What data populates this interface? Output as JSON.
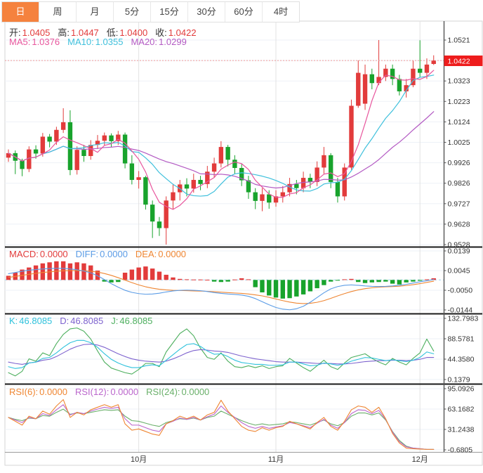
{
  "tabs": [
    {
      "label": "日",
      "selected": true
    },
    {
      "label": "周",
      "selected": false
    },
    {
      "label": "月",
      "selected": false
    },
    {
      "label": "5分",
      "selected": false
    },
    {
      "label": "15分",
      "selected": false
    },
    {
      "label": "30分",
      "selected": false
    },
    {
      "label": "60分",
      "selected": false
    },
    {
      "label": "4时",
      "selected": false
    }
  ],
  "legends": {
    "ohlc": [
      {
        "label": "开:",
        "value": "1.0405"
      },
      {
        "label": "高:",
        "value": "1.0447"
      },
      {
        "label": "低:",
        "value": "1.0400"
      },
      {
        "label": "收:",
        "value": "1.0422"
      }
    ],
    "ma": [
      {
        "label": "MA5:",
        "value": "1.0376",
        "color": "ma5"
      },
      {
        "label": "MA10:",
        "value": "1.0355",
        "color": "ma10"
      },
      {
        "label": "MA20:",
        "value": "1.0299",
        "color": "ma20"
      }
    ],
    "macd": [
      {
        "label": "MACD:",
        "value": "0.0000",
        "color": "up"
      },
      {
        "label": "DIFF:",
        "value": "0.0000",
        "color": "diff"
      },
      {
        "label": "DEA:",
        "value": "0.0000",
        "color": "dea"
      }
    ],
    "kdj": [
      {
        "label": "K:",
        "value": "46.8085",
        "color": "k"
      },
      {
        "label": "D:",
        "value": "46.8085",
        "color": "d"
      },
      {
        "label": "J:",
        "value": "46.8085",
        "color": "j"
      }
    ],
    "rsi": [
      {
        "label": "RSI(6):",
        "value": "0.0000",
        "color": "rsi6"
      },
      {
        "label": "RSI(12):",
        "value": "0.0000",
        "color": "rsi12"
      },
      {
        "label": "RSI(24):",
        "value": "0.0000",
        "color": "rsi24"
      }
    ]
  },
  "colors": {
    "up": "#e23b3b",
    "down": "#18a32c",
    "tag": "#ee1c1c",
    "tagText": "#ffffff",
    "ma5": "#e8569d",
    "ma10": "#3fc0dc",
    "ma20": "#b35ac3",
    "diff": "#5b9ce6",
    "dea": "#ef8632",
    "k": "#2fc2dc",
    "d": "#7d62ce",
    "j": "#4daf5e",
    "rsi6": "#ef8632",
    "rsi12": "#bb66cc",
    "rsi24": "#6ab06a",
    "grid": "#edf1f7",
    "monthLine": "#e2e2e2",
    "frame": "#d6d6d6",
    "axisLine": "#555555",
    "axisText": "#333333",
    "sep": "#1a1a1a",
    "priceDotted": "#ef9a9a",
    "macdZero": "#9fd4ef"
  },
  "chart_data": {
    "type": "candlestick",
    "current_price": "1.0422",
    "ylim_main": [
      0.9528,
      1.0521
    ],
    "ma_periods": [
      5,
      10,
      20
    ],
    "y_axis": {
      "main": [
        "1.0521",
        "1.0422",
        "1.0323",
        "1.0223",
        "1.0124",
        "1.0025",
        "0.9926",
        "0.9826",
        "0.9727",
        "0.9628",
        "0.9528"
      ],
      "macd": [
        "0.0139",
        "0.0045",
        "-0.0050",
        "-0.0144"
      ],
      "kdj": [
        "132.7983",
        "88.5781",
        "44.3580",
        "0.1379"
      ],
      "rsi": [
        "95.0926",
        "63.1682",
        "31.2438",
        "-0.6805"
      ]
    },
    "x_axis": {
      "labels": [
        "10月",
        "11月",
        "12月"
      ],
      "candle_indices": [
        19,
        39,
        60
      ]
    },
    "candles": [
      [
        0.995,
        0.999,
        0.993,
        0.9972
      ],
      [
        0.9972,
        0.9985,
        0.987,
        0.9935
      ],
      [
        0.9935,
        0.9945,
        0.986,
        0.9895
      ],
      [
        0.9895,
        1.0005,
        0.988,
        0.999
      ],
      [
        0.999,
        1.001,
        0.9945,
        0.997
      ],
      [
        0.997,
        1.007,
        0.9955,
        1.0052
      ],
      [
        1.0052,
        1.0065,
        1.0,
        1.0028
      ],
      [
        1.0028,
        1.01,
        1.0012,
        1.0085
      ],
      [
        1.0085,
        1.019,
        1.007,
        1.0122
      ],
      [
        1.0122,
        1.018,
        0.9865,
        0.989
      ],
      [
        0.989,
        1.0005,
        0.9868,
        0.9988
      ],
      [
        0.9988,
        1.0012,
        0.993,
        0.9958
      ],
      [
        0.9958,
        1.0035,
        0.994,
        1.0012
      ],
      [
        1.0012,
        1.006,
        0.9992,
        1.0032
      ],
      [
        1.0032,
        1.0072,
        1.001,
        1.0058
      ],
      [
        1.0058,
        1.0068,
        1.0002,
        1.003
      ],
      [
        1.003,
        1.008,
        1.0012,
        1.0062
      ],
      [
        1.0062,
        1.0072,
        0.9898,
        0.9922
      ],
      [
        0.9922,
        0.9962,
        0.982,
        0.9842
      ],
      [
        0.9842,
        0.9885,
        0.98,
        0.9855
      ],
      [
        0.9855,
        0.9862,
        0.9698,
        0.9722
      ],
      [
        0.9722,
        0.9742,
        0.956,
        0.964
      ],
      [
        0.964,
        0.9662,
        0.957,
        0.9608
      ],
      [
        0.9608,
        0.9762,
        0.9528,
        0.9742
      ],
      [
        0.9742,
        0.982,
        0.9702,
        0.9782
      ],
      [
        0.9782,
        0.9842,
        0.9742,
        0.982
      ],
      [
        0.982,
        0.985,
        0.9762,
        0.98
      ],
      [
        0.98,
        0.9872,
        0.978,
        0.9842
      ],
      [
        0.9842,
        0.9862,
        0.9792,
        0.9822
      ],
      [
        0.9822,
        0.991,
        0.9802,
        0.9882
      ],
      [
        0.9882,
        0.995,
        0.9852,
        0.9922
      ],
      [
        0.9922,
        1.003,
        0.9902,
        1.0002
      ],
      [
        1.0002,
        1.0012,
        0.9908,
        0.994
      ],
      [
        0.994,
        0.9962,
        0.9872,
        0.99
      ],
      [
        0.99,
        0.992,
        0.9812,
        0.984
      ],
      [
        0.984,
        0.9862,
        0.975,
        0.9782
      ],
      [
        0.9782,
        0.9802,
        0.97,
        0.974
      ],
      [
        0.974,
        0.9802,
        0.969,
        0.9772
      ],
      [
        0.9772,
        0.9792,
        0.9702,
        0.9732
      ],
      [
        0.9732,
        0.9792,
        0.9712,
        0.9762
      ],
      [
        0.9762,
        0.9812,
        0.9732,
        0.9782
      ],
      [
        0.9782,
        0.9852,
        0.9762,
        0.9822
      ],
      [
        0.9822,
        0.9842,
        0.9772,
        0.9802
      ],
      [
        0.9802,
        0.9882,
        0.9782,
        0.9852
      ],
      [
        0.9852,
        0.9872,
        0.9802,
        0.9832
      ],
      [
        0.9832,
        0.9932,
        0.9812,
        0.9902
      ],
      [
        0.9902,
        1.0002,
        0.9872,
        0.9962
      ],
      [
        0.9962,
        0.9972,
        0.9802,
        0.9832
      ],
      [
        0.9832,
        0.9852,
        0.9732,
        0.9762
      ],
      [
        0.9762,
        0.9922,
        0.9742,
        0.9902
      ],
      [
        0.9902,
        1.0232,
        0.9892,
        1.0202
      ],
      [
        1.0202,
        1.0422,
        1.0192,
        1.0362
      ],
      [
        1.0212,
        1.0402,
        1.0182,
        1.0355
      ],
      [
        1.0355,
        1.0382,
        1.0282,
        1.0312
      ],
      [
        1.0312,
        1.0521,
        1.0302,
        1.0342
      ],
      [
        1.0342,
        1.0402,
        1.0322,
        1.0382
      ],
      [
        1.0382,
        1.0402,
        1.0302,
        1.0332
      ],
      [
        1.0332,
        1.0352,
        1.0252,
        1.0272
      ],
      [
        1.0272,
        1.0332,
        1.0242,
        1.0302
      ],
      [
        1.0302,
        1.0422,
        1.0292,
        1.0382
      ],
      [
        1.0382,
        1.052,
        1.0342,
        1.0362
      ],
      [
        1.0362,
        1.0432,
        1.0332,
        1.0402
      ],
      [
        1.0405,
        1.0447,
        1.04,
        1.0422
      ]
    ],
    "macd": {
      "hist": [
        0.002,
        0.0035,
        0.005,
        0.006,
        0.007,
        0.008,
        0.0085,
        0.009,
        0.009,
        0.008,
        0.0085,
        0.008,
        0.007,
        0.0045,
        -0.0008,
        -0.0012,
        -0.001,
        0.0035,
        0.005,
        0.006,
        0.0065,
        0.0055,
        0.004,
        0.0025,
        0.0012,
        0.0005,
        0.0003,
        0.0002,
        0.0002,
        0.0001,
        -0.0008,
        -0.001,
        -0.0008,
        0.0002,
        0.0008,
        0.0003,
        -0.0035,
        -0.006,
        -0.0075,
        -0.0085,
        -0.009,
        -0.0088,
        -0.008,
        -0.007,
        -0.0055,
        -0.004,
        -0.0025,
        -0.0008,
        -0.0003,
        0.0003,
        0.0005,
        -0.001,
        -0.0015,
        -0.0012,
        -0.001,
        -0.0008,
        -0.0018,
        -0.0022,
        -0.0012,
        -0.0008,
        -0.0004,
        0.0003,
        0.0008
      ],
      "diff": [
        0.003,
        0.0036,
        0.0042,
        0.0047,
        0.005,
        0.0053,
        0.0055,
        0.0056,
        0.0056,
        0.0053,
        0.0049,
        0.0043,
        0.0034,
        0.002,
        0.0002,
        -0.0018,
        -0.0035,
        -0.005,
        -0.006,
        -0.0066,
        -0.0069,
        -0.0068,
        -0.0064,
        -0.0058,
        -0.0053,
        -0.005,
        -0.0049,
        -0.005,
        -0.0052,
        -0.0056,
        -0.0061,
        -0.0065,
        -0.0068,
        -0.007,
        -0.0073,
        -0.0079,
        -0.009,
        -0.0105,
        -0.012,
        -0.0133,
        -0.0141,
        -0.0144,
        -0.0139,
        -0.0127,
        -0.0108,
        -0.0085,
        -0.0062,
        -0.0043,
        -0.0032,
        -0.0026,
        -0.0024,
        -0.0026,
        -0.0029,
        -0.0031,
        -0.0032,
        -0.0031,
        -0.0029,
        -0.0026,
        -0.0021,
        -0.0015,
        -0.0009,
        -0.0004,
        0.0002
      ],
      "dea": [
        0.0012,
        0.0017,
        0.0022,
        0.0027,
        0.0032,
        0.0036,
        0.0039,
        0.0042,
        0.0044,
        0.0045,
        0.0045,
        0.0044,
        0.0042,
        0.0038,
        0.0031,
        0.0022,
        0.0011,
        -0.0001,
        -0.0013,
        -0.0024,
        -0.0033,
        -0.004,
        -0.0045,
        -0.0048,
        -0.005,
        -0.0051,
        -0.0052,
        -0.0053,
        -0.0054,
        -0.0055,
        -0.0057,
        -0.0059,
        -0.0061,
        -0.0063,
        -0.0065,
        -0.0068,
        -0.0072,
        -0.0077,
        -0.0084,
        -0.0092,
        -0.01,
        -0.0107,
        -0.0112,
        -0.0114,
        -0.0113,
        -0.0108,
        -0.01,
        -0.0089,
        -0.0077,
        -0.0066,
        -0.0056,
        -0.0048,
        -0.0042,
        -0.0038,
        -0.0035,
        -0.0033,
        -0.0032,
        -0.003,
        -0.0027,
        -0.0023,
        -0.0018,
        -0.0012,
        -0.0006
      ]
    },
    "kdj": {
      "k": [
        28,
        24,
        26,
        36,
        38,
        46,
        48,
        58,
        70,
        80,
        85,
        85,
        80,
        70,
        56,
        44,
        36,
        30,
        26,
        26,
        30,
        32,
        30,
        42,
        54,
        66,
        76,
        78,
        72,
        62,
        55,
        56,
        50,
        42,
        37,
        35,
        33,
        33,
        31,
        31,
        32,
        38,
        38,
        34,
        30,
        31,
        36,
        34,
        31,
        34,
        40,
        44,
        48,
        47,
        44,
        41,
        43,
        41,
        39,
        42,
        48,
        60,
        56
      ],
      "d": [
        38,
        35,
        33,
        36,
        38,
        42,
        44,
        50,
        58,
        66,
        72,
        76,
        77,
        75,
        70,
        63,
        56,
        50,
        45,
        42,
        40,
        39,
        38,
        40,
        45,
        51,
        58,
        63,
        65,
        64,
        62,
        61,
        59,
        55,
        51,
        48,
        45,
        43,
        41,
        39,
        38,
        38,
        38,
        37,
        36,
        35,
        35,
        35,
        34,
        34,
        35,
        37,
        39,
        40,
        41,
        41,
        42,
        42,
        41,
        42,
        44,
        48,
        48
      ],
      "j": [
        15,
        8,
        18,
        45,
        40,
        58,
        52,
        78,
        98,
        110,
        112,
        105,
        88,
        62,
        38,
        25,
        20,
        15,
        12,
        22,
        35,
        35,
        28,
        60,
        80,
        100,
        110,
        95,
        68,
        48,
        44,
        58,
        40,
        28,
        26,
        30,
        26,
        30,
        24,
        28,
        30,
        46,
        36,
        26,
        18,
        30,
        42,
        28,
        22,
        36,
        48,
        52,
        56,
        46,
        38,
        32,
        46,
        38,
        32,
        46,
        58,
        88,
        62
      ]
    },
    "rsi": {
      "rsi6": [
        50,
        44,
        38,
        52,
        48,
        60,
        55,
        68,
        78,
        50,
        58,
        54,
        62,
        66,
        70,
        66,
        70,
        40,
        30,
        32,
        28,
        24,
        22,
        40,
        45,
        52,
        48,
        52,
        46,
        54,
        58,
        77,
        60,
        48,
        36,
        30,
        28,
        34,
        30,
        34,
        36,
        44,
        40,
        36,
        32,
        42,
        50,
        36,
        30,
        44,
        62,
        68,
        66,
        58,
        66,
        48,
        25,
        10,
        2,
        1,
        0.5,
        0,
        0
      ],
      "rsi12": [
        50,
        46,
        42,
        50,
        48,
        56,
        53,
        62,
        70,
        54,
        58,
        56,
        60,
        63,
        66,
        64,
        66,
        48,
        38,
        38,
        34,
        30,
        28,
        40,
        44,
        49,
        47,
        50,
        46,
        51,
        55,
        68,
        58,
        50,
        42,
        36,
        33,
        36,
        33,
        35,
        37,
        42,
        40,
        37,
        34,
        41,
        47,
        38,
        33,
        42,
        56,
        62,
        61,
        56,
        61,
        47,
        27,
        12,
        4,
        2,
        1,
        0,
        0
      ],
      "rsi24": [
        50,
        47,
        45,
        49,
        48,
        53,
        52,
        58,
        63,
        55,
        57,
        56,
        58,
        60,
        62,
        61,
        62,
        52,
        45,
        44,
        41,
        38,
        36,
        42,
        45,
        48,
        47,
        49,
        46,
        50,
        52,
        60,
        55,
        50,
        45,
        41,
        38,
        40,
        38,
        39,
        40,
        43,
        42,
        40,
        38,
        42,
        46,
        40,
        37,
        42,
        52,
        57,
        57,
        54,
        57,
        46,
        28,
        14,
        5,
        2,
        1,
        0,
        0
      ]
    }
  }
}
